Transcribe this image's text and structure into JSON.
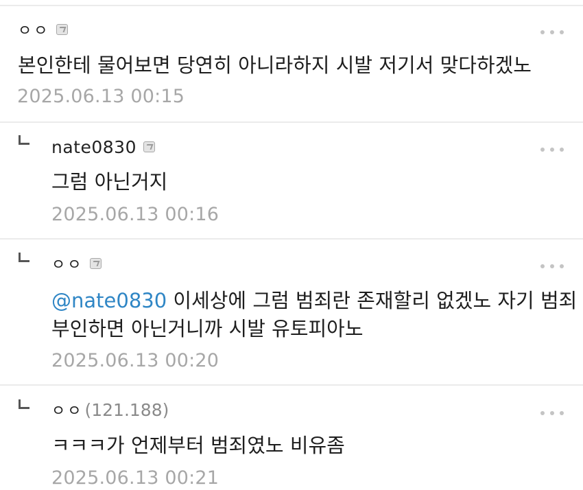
{
  "comments": [
    {
      "author": "ㅇㅇ",
      "ip": "",
      "badge": "gallery-member-icon",
      "is_reply": false,
      "mention": "",
      "lines": [
        "본인한테 물어보면 당연히 아니라하지 시발 저기서 맞다하겠노"
      ],
      "timestamp": "2025.06.13 00:15"
    },
    {
      "author": "nate0830",
      "ip": "",
      "badge": "gallery-member-icon",
      "is_reply": true,
      "mention": "",
      "lines": [
        "그럼 아닌거지"
      ],
      "timestamp": "2025.06.13 00:16"
    },
    {
      "author": "ㅇㅇ",
      "ip": "",
      "badge": "gallery-member-icon",
      "is_reply": true,
      "mention": "@nate0830",
      "lines": [
        "이세상에 그럼 범죄란 존재할리 없겠노 자기 범죄",
        "부인하면 아닌거니까 시발 유토피아노"
      ],
      "timestamp": "2025.06.13 00:20"
    },
    {
      "author": "ㅇㅇ",
      "ip": "(121.188)",
      "badge": "",
      "is_reply": true,
      "mention": "",
      "lines": [
        "ㅋㅋㅋ가 언제부터 범죄였노 비유좀"
      ],
      "timestamp": "2025.06.13 00:21"
    }
  ],
  "icons": {
    "more": "more-options-icon",
    "reply": "reply-arrow-icon"
  },
  "colors": {
    "mention": "#2f86c5",
    "timestamp": "#a7a7a7",
    "divider": "#ebebeb"
  }
}
